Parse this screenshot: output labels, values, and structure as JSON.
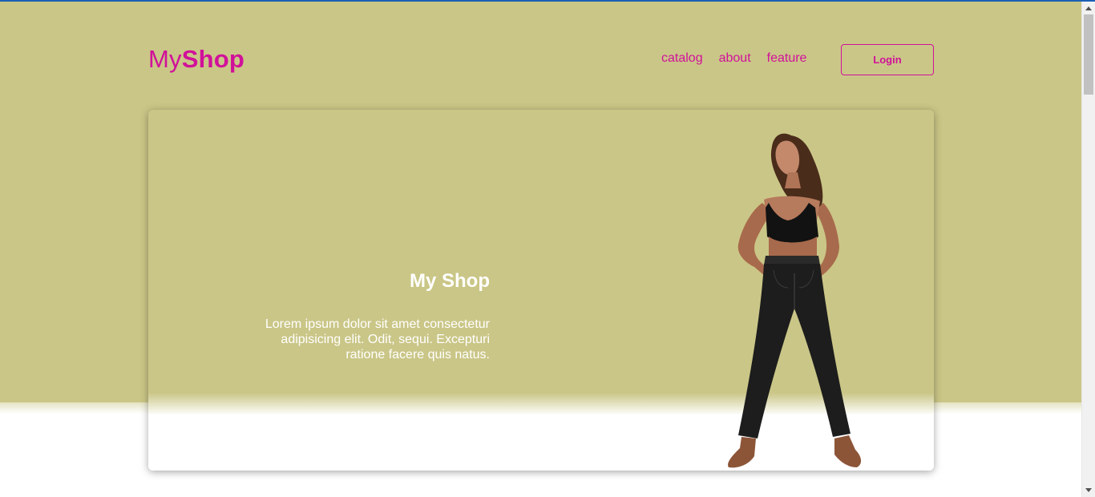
{
  "brand": {
    "logo_light": "My",
    "logo_bold": "Shop",
    "accent_color": "#d1119a",
    "background_color": "#cac687"
  },
  "nav": {
    "items": [
      {
        "label": "catalog"
      },
      {
        "label": "about"
      },
      {
        "label": "feature"
      }
    ],
    "login_label": "Login"
  },
  "hero": {
    "title": "My Shop",
    "body": "Lorem ipsum dolor sit amet consectetur adipisicing elit. Odit, sequi. Excepturi ratione facere quis natus.",
    "image_icon": "woman-standing-illustration"
  },
  "scrollbar": {
    "up_icon": "arrow-up-icon",
    "down_icon": "arrow-down-icon"
  }
}
